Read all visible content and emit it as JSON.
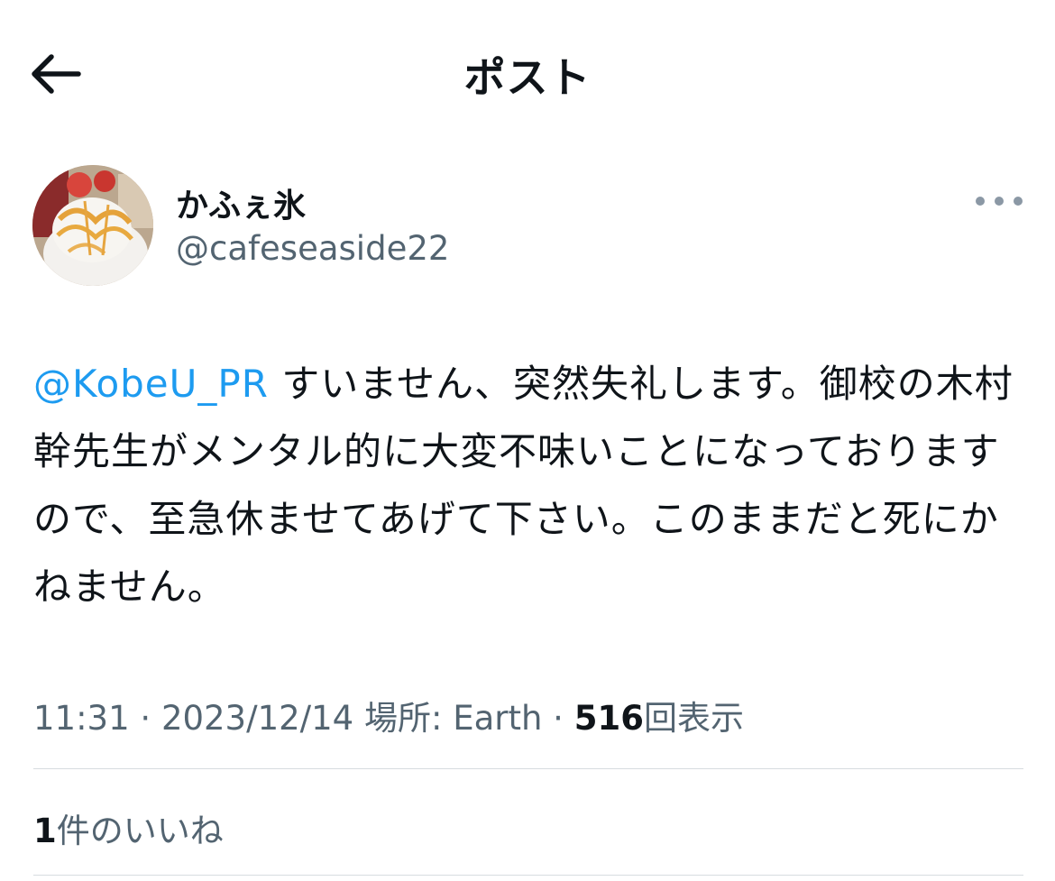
{
  "header": {
    "title": "ポスト",
    "back_icon": "arrow-left-icon"
  },
  "author": {
    "display_name": "かふぇ氷",
    "handle": "@cafeseaside22",
    "avatar_icon": "shaved-ice-avatar"
  },
  "post": {
    "mention": "@KobeU_PR",
    "text_after_mention": " すいません、突然失礼します。御校の木村幹先生がメンタル的に大変不味いことになっておりますので、至急休ませてあげて下さい。このままだと死にかねません。"
  },
  "meta": {
    "time": "11:31",
    "separator1": " · ",
    "date": "2023/12/14",
    "location_label": "場所: Earth",
    "separator2": " · ",
    "views_count": "516",
    "views_label": "回表示"
  },
  "engagement": {
    "likes_count": "1",
    "likes_label": "件のいいね"
  },
  "colors": {
    "mention": "#1d9bf0",
    "secondary_text": "#536471",
    "primary_text": "#0f1419",
    "divider": "#d7dce0"
  }
}
